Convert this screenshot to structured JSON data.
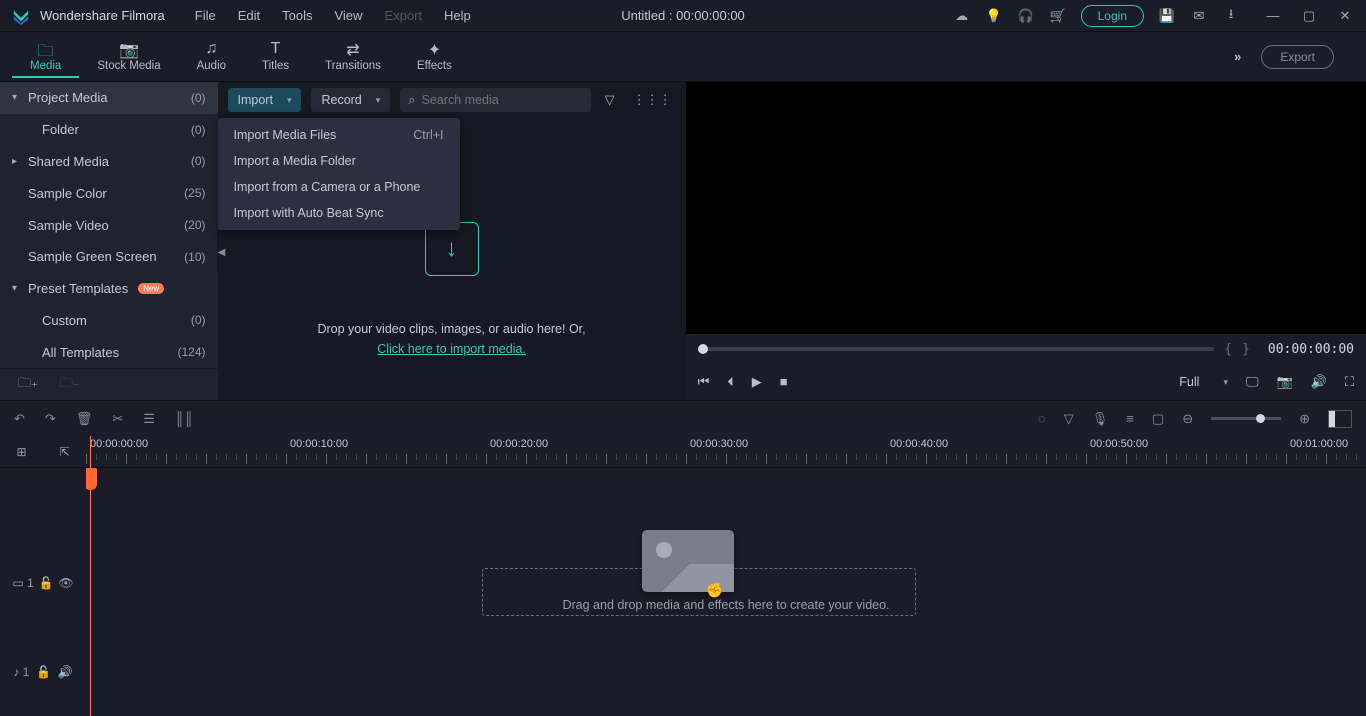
{
  "app": {
    "name": "Wondershare Filmora",
    "title": "Untitled : 00:00:00:00",
    "login": "Login"
  },
  "menubar": [
    "File",
    "Edit",
    "Tools",
    "View",
    "Export",
    "Help"
  ],
  "menubar_disabled_index": 4,
  "tabs": [
    {
      "label": "Media",
      "active": true
    },
    {
      "label": "Stock Media"
    },
    {
      "label": "Audio"
    },
    {
      "label": "Titles"
    },
    {
      "label": "Transitions"
    },
    {
      "label": "Effects"
    }
  ],
  "export_label": "Export",
  "sidebar": {
    "items": [
      {
        "label": "Project Media",
        "count": "(0)",
        "arrow": "▾",
        "selected": true
      },
      {
        "label": "Folder",
        "count": "(0)",
        "sub": 2
      },
      {
        "label": "Shared Media",
        "count": "(0)",
        "arrow": "▸"
      },
      {
        "label": "Sample Color",
        "count": "(25)",
        "sub": 1
      },
      {
        "label": "Sample Video",
        "count": "(20)",
        "sub": 1
      },
      {
        "label": "Sample Green Screen",
        "count": "(10)",
        "sub": 1
      },
      {
        "label": "Preset Templates",
        "count": "",
        "arrow": "▾",
        "new": true
      },
      {
        "label": "Custom",
        "count": "(0)",
        "sub": 2
      },
      {
        "label": "All Templates",
        "count": "(124)",
        "sub": 2
      }
    ]
  },
  "media_toolbar": {
    "import": "Import",
    "record": "Record",
    "search_placeholder": "Search media"
  },
  "import_menu": [
    {
      "label": "Import Media Files",
      "shortcut": "Ctrl+I"
    },
    {
      "label": "Import a Media Folder",
      "shortcut": ""
    },
    {
      "label": "Import from a Camera or a Phone",
      "shortcut": ""
    },
    {
      "label": "Import with Auto Beat Sync",
      "shortcut": ""
    }
  ],
  "media_drop": {
    "line1": "Drop your video clips, images, or audio here! Or,",
    "link": "Click here to import media."
  },
  "preview": {
    "time": "00:00:00:00",
    "fit": "Full"
  },
  "timeline": {
    "hint": "Drag and drop media and effects here to create your video.",
    "ruler": [
      "00:00:00:00",
      "00:00:10:00",
      "00:00:20:00",
      "00:00:30:00",
      "00:00:40:00",
      "00:00:50:00",
      "00:01:00:00"
    ]
  }
}
